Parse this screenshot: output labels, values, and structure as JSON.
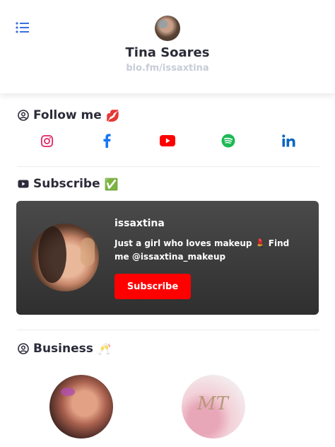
{
  "profile": {
    "name": "Tina Soares",
    "url": "bio.fm/issaxtina"
  },
  "sections": {
    "follow": {
      "title": "Follow me",
      "emoji": "💋"
    },
    "subscribe": {
      "title": "Subscribe",
      "emoji": "✅"
    },
    "business": {
      "title": "Business",
      "emoji": "🥂"
    }
  },
  "social_links": [
    "instagram-icon",
    "facebook-icon",
    "youtube-icon",
    "spotify-icon",
    "linkedin-icon"
  ],
  "youtube_card": {
    "channel_name": "issaxtina",
    "description": "Just a girl who loves makeup 💄 Find me @issaxtina_makeup",
    "button_label": "Subscribe"
  },
  "business_items": {
    "second_logo_text": "MT"
  },
  "colors": {
    "menu_blue": "#3d6fe0",
    "instagram": "#e1306c",
    "facebook": "#1877f2",
    "youtube": "#ff0000",
    "spotify": "#1db954",
    "linkedin": "#0a66c2"
  }
}
